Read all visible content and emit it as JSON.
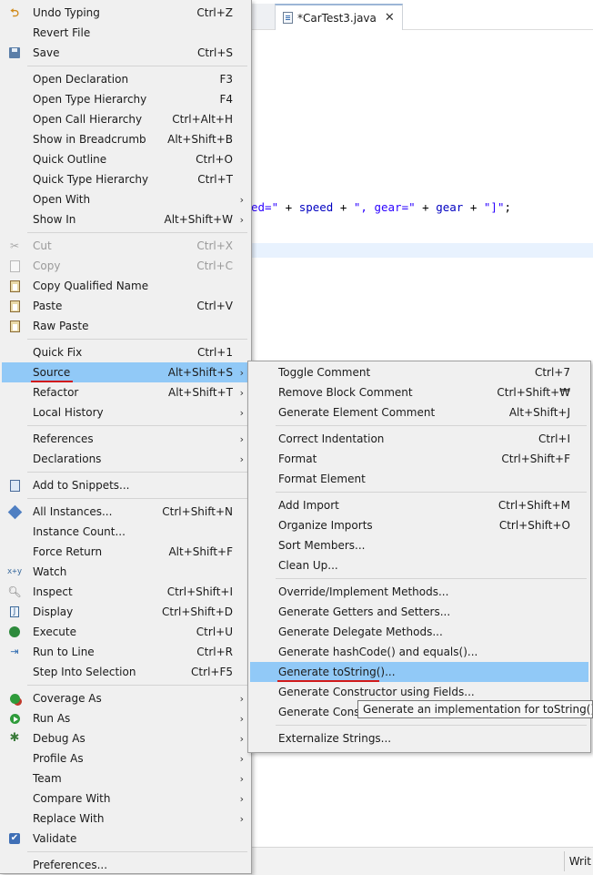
{
  "editor": {
    "tab_title": "*CarTest3.java",
    "tab_close": "✕",
    "code_line": {
      "p1": "ed=\"",
      "p2": " + ",
      "p3": "speed",
      "p4": " + ",
      "p5": "\", gear=\"",
      "p6": " + ",
      "p7": "gear",
      "p8": " + ",
      "p9": "\"]\"",
      "p10": ";"
    },
    "status_writable": "Writ"
  },
  "context_menu": {
    "items": [
      {
        "label": "Undo Typing",
        "accel": "Ctrl+Z",
        "icon": "undo-icon"
      },
      {
        "label": "Revert File",
        "accel": ""
      },
      {
        "label": "Save",
        "accel": "Ctrl+S",
        "icon": "save-icon"
      },
      {
        "label": "Open Declaration",
        "accel": "F3"
      },
      {
        "label": "Open Type Hierarchy",
        "accel": "F4"
      },
      {
        "label": "Open Call Hierarchy",
        "accel": "Ctrl+Alt+H"
      },
      {
        "label": "Show in Breadcrumb",
        "accel": "Alt+Shift+B"
      },
      {
        "label": "Quick Outline",
        "accel": "Ctrl+O"
      },
      {
        "label": "Quick Type Hierarchy",
        "accel": "Ctrl+T"
      },
      {
        "label": "Open With",
        "accel": ""
      },
      {
        "label": "Show In",
        "accel": "Alt+Shift+W"
      },
      {
        "label": "Cut",
        "accel": "Ctrl+X",
        "icon": "cut-icon"
      },
      {
        "label": "Copy",
        "accel": "Ctrl+C",
        "icon": "copy-icon"
      },
      {
        "label": "Copy Qualified Name",
        "accel": "",
        "icon": "copy-qualified-icon"
      },
      {
        "label": "Paste",
        "accel": "Ctrl+V",
        "icon": "paste-icon"
      },
      {
        "label": "Raw Paste",
        "accel": "",
        "icon": "raw-paste-icon"
      },
      {
        "label": "Quick Fix",
        "accel": "Ctrl+1"
      },
      {
        "label": "Source",
        "accel": "Alt+Shift+S"
      },
      {
        "label": "Refactor",
        "accel": "Alt+Shift+T"
      },
      {
        "label": "Local History",
        "accel": ""
      },
      {
        "label": "References",
        "accel": ""
      },
      {
        "label": "Declarations",
        "accel": ""
      },
      {
        "label": "Add to Snippets...",
        "accel": "",
        "icon": "snippet-icon"
      },
      {
        "label": "All Instances...",
        "accel": "Ctrl+Shift+N",
        "icon": "instances-icon"
      },
      {
        "label": "Instance Count...",
        "accel": ""
      },
      {
        "label": "Force Return",
        "accel": "Alt+Shift+F"
      },
      {
        "label": "Watch",
        "accel": "",
        "icon": "watch-icon"
      },
      {
        "label": "Inspect",
        "accel": "Ctrl+Shift+I",
        "icon": "inspect-icon"
      },
      {
        "label": "Display",
        "accel": "Ctrl+Shift+D",
        "icon": "display-icon"
      },
      {
        "label": "Execute",
        "accel": "Ctrl+U",
        "icon": "execute-icon"
      },
      {
        "label": "Run to Line",
        "accel": "Ctrl+R",
        "icon": "run-to-line-icon"
      },
      {
        "label": "Step Into Selection",
        "accel": "Ctrl+F5"
      },
      {
        "label": "Coverage As",
        "accel": "",
        "icon": "coverage-icon"
      },
      {
        "label": "Run As",
        "accel": "",
        "icon": "run-icon"
      },
      {
        "label": "Debug As",
        "accel": "",
        "icon": "bug-icon"
      },
      {
        "label": "Profile As",
        "accel": ""
      },
      {
        "label": "Team",
        "accel": ""
      },
      {
        "label": "Compare With",
        "accel": ""
      },
      {
        "label": "Replace With",
        "accel": ""
      },
      {
        "label": "Validate",
        "accel": "",
        "icon": "validate-icon"
      },
      {
        "label": "Preferences...",
        "accel": ""
      }
    ],
    "submenu_arrow": "›",
    "highlighted": "Source"
  },
  "source_submenu": {
    "items": [
      {
        "label": "Toggle Comment",
        "accel": "Ctrl+7"
      },
      {
        "label": "Remove Block Comment",
        "accel": "Ctrl+Shift+₩"
      },
      {
        "label": "Generate Element Comment",
        "accel": "Alt+Shift+J"
      },
      {
        "label": "Correct Indentation",
        "accel": "Ctrl+I"
      },
      {
        "label": "Format",
        "accel": "Ctrl+Shift+F"
      },
      {
        "label": "Format Element",
        "accel": ""
      },
      {
        "label": "Add Import",
        "accel": "Ctrl+Shift+M"
      },
      {
        "label": "Organize Imports",
        "accel": "Ctrl+Shift+O"
      },
      {
        "label": "Sort Members...",
        "accel": ""
      },
      {
        "label": "Clean Up...",
        "accel": ""
      },
      {
        "label": "Override/Implement Methods...",
        "accel": ""
      },
      {
        "label": "Generate Getters and Setters...",
        "accel": ""
      },
      {
        "label": "Generate Delegate Methods...",
        "accel": ""
      },
      {
        "label": "Generate hashCode() and equals()...",
        "accel": ""
      },
      {
        "label": "Generate toString()...",
        "accel": ""
      },
      {
        "label": "Generate Constructor using Fields...",
        "accel": ""
      },
      {
        "label": "Generate Constr",
        "accel": ""
      },
      {
        "label": "Externalize Strings...",
        "accel": ""
      }
    ],
    "highlighted": "Generate toString()..."
  },
  "tooltip": {
    "text": "Generate an implementation for toString() meth"
  },
  "colors": {
    "menu_bg": "#f0f0f0",
    "highlight": "#91c9f7",
    "annotation_underline": "#d11a1a",
    "current_line": "#e8f2fe"
  }
}
